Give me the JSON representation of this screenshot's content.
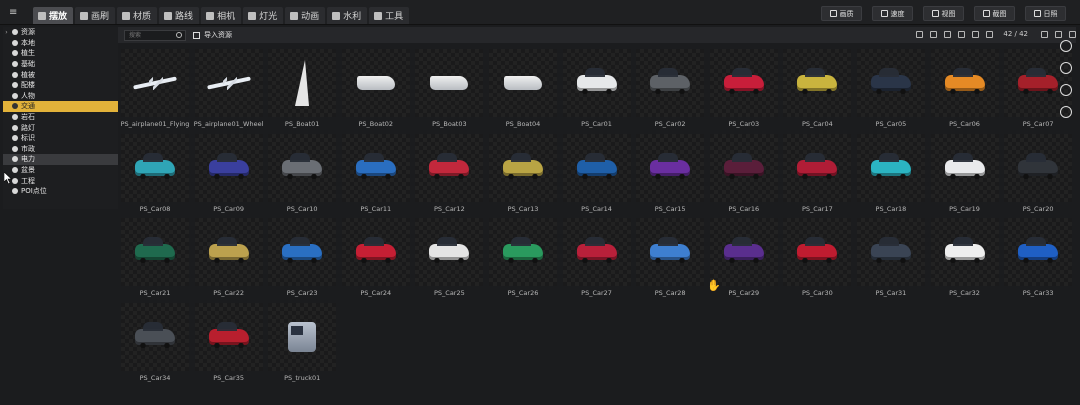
{
  "topbar": {
    "tabs": [
      {
        "label": "摆放",
        "icon": "place-icon",
        "active": true
      },
      {
        "label": "画刷",
        "icon": "brush-icon"
      },
      {
        "label": "材质",
        "icon": "material-icon"
      },
      {
        "label": "路线",
        "icon": "route-icon"
      },
      {
        "label": "相机",
        "icon": "camera-icon"
      },
      {
        "label": "灯光",
        "icon": "light-icon"
      },
      {
        "label": "动画",
        "icon": "animation-icon"
      },
      {
        "label": "水利",
        "icon": "water-icon"
      },
      {
        "label": "工具",
        "icon": "tool-icon"
      }
    ],
    "right_buttons": [
      {
        "label": "画质",
        "icon": "image-quality-icon"
      },
      {
        "label": "速度",
        "icon": "speed-icon"
      },
      {
        "label": "视图",
        "icon": "view-icon"
      },
      {
        "label": "截图",
        "icon": "screenshot-icon"
      },
      {
        "label": "日照",
        "icon": "sun-icon"
      }
    ]
  },
  "sidebar": {
    "items": [
      {
        "label": "资源",
        "arrow": "›"
      },
      {
        "label": "本地",
        "arrow": ""
      },
      {
        "label": "植生",
        "arrow": ""
      },
      {
        "label": "基础",
        "arrow": ""
      },
      {
        "label": "植被",
        "arrow": ""
      },
      {
        "label": "配楼",
        "arrow": ""
      },
      {
        "label": "人物",
        "arrow": ""
      },
      {
        "label": "交通",
        "arrow": "",
        "selected": true
      },
      {
        "label": "岩石",
        "arrow": ""
      },
      {
        "label": "路灯",
        "arrow": ""
      },
      {
        "label": "标识",
        "arrow": ""
      },
      {
        "label": "市政",
        "arrow": ""
      },
      {
        "label": "电力",
        "arrow": "",
        "hover": true
      },
      {
        "label": "盆景",
        "arrow": ""
      },
      {
        "label": "工程",
        "arrow": ""
      },
      {
        "label": "POI点位",
        "arrow": ""
      }
    ]
  },
  "toolbar": {
    "search_placeholder": "搜索",
    "import_label": "导入资源",
    "pager": "42 / 42"
  },
  "assets": [
    {
      "name": "PS_airplane01_Flying",
      "kind": "plane"
    },
    {
      "name": "PS_airplane01_Wheel",
      "kind": "plane"
    },
    {
      "name": "PS_Boat01",
      "kind": "sail"
    },
    {
      "name": "PS_Boat02",
      "kind": "boat"
    },
    {
      "name": "PS_Boat03",
      "kind": "boat"
    },
    {
      "name": "PS_Boat04",
      "kind": "boat"
    },
    {
      "name": "PS_Car01",
      "kind": "car",
      "color": "#e6e8ea"
    },
    {
      "name": "PS_Car02",
      "kind": "car",
      "color": "#5d6166"
    },
    {
      "name": "PS_Car03",
      "kind": "car",
      "color": "#c81e3a"
    },
    {
      "name": "PS_Car04",
      "kind": "car",
      "color": "#c9b43e"
    },
    {
      "name": "PS_Car05",
      "kind": "car",
      "color": "#2a3548"
    },
    {
      "name": "PS_Car06",
      "kind": "car",
      "color": "#e58a25"
    },
    {
      "name": "PS_Car07",
      "kind": "car",
      "color": "#a5202a"
    },
    {
      "name": "PS_Car08",
      "kind": "car",
      "color": "#2fa5b6"
    },
    {
      "name": "PS_Car09",
      "kind": "car",
      "color": "#3a3f9e"
    },
    {
      "name": "PS_Car10",
      "kind": "car",
      "color": "#6a6e74"
    },
    {
      "name": "PS_Car11",
      "kind": "car",
      "color": "#2a6ec0"
    },
    {
      "name": "PS_Car12",
      "kind": "car",
      "color": "#c2283c"
    },
    {
      "name": "PS_Car13",
      "kind": "car",
      "color": "#b9a444"
    },
    {
      "name": "PS_Car14",
      "kind": "car",
      "color": "#1f5fa8"
    },
    {
      "name": "PS_Car15",
      "kind": "car",
      "color": "#6a2ea0"
    },
    {
      "name": "PS_Car16",
      "kind": "car",
      "color": "#5a1e3a"
    },
    {
      "name": "PS_Car17",
      "kind": "car",
      "color": "#b01d36"
    },
    {
      "name": "PS_Car18",
      "kind": "car",
      "color": "#2bb4c2"
    },
    {
      "name": "PS_Car19",
      "kind": "car",
      "color": "#e9eaec"
    },
    {
      "name": "PS_Car20",
      "kind": "car",
      "color": "#30343a"
    },
    {
      "name": "PS_Car21",
      "kind": "car",
      "color": "#1f6a4e"
    },
    {
      "name": "PS_Car22",
      "kind": "car",
      "color": "#bca14e"
    },
    {
      "name": "PS_Car23",
      "kind": "car",
      "color": "#2a6fc2"
    },
    {
      "name": "PS_Car24",
      "kind": "car",
      "color": "#c51f34"
    },
    {
      "name": "PS_Car25",
      "kind": "car",
      "color": "#e4e4e4"
    },
    {
      "name": "PS_Car26",
      "kind": "car",
      "color": "#2a9a5e"
    },
    {
      "name": "PS_Car27",
      "kind": "car",
      "color": "#b8203a"
    },
    {
      "name": "PS_Car28",
      "kind": "car",
      "color": "#3e7fd0"
    },
    {
      "name": "PS_Car29",
      "kind": "car",
      "color": "#5a2e8e"
    },
    {
      "name": "PS_Car30",
      "kind": "car",
      "color": "#c01c30"
    },
    {
      "name": "PS_Car31",
      "kind": "car",
      "color": "#3a4454"
    },
    {
      "name": "PS_Car32",
      "kind": "car",
      "color": "#eeeeee"
    },
    {
      "name": "PS_Car33",
      "kind": "car",
      "color": "#1f5fc4"
    },
    {
      "name": "PS_Car34",
      "kind": "car",
      "color": "#4a4f56"
    },
    {
      "name": "PS_Car35",
      "kind": "car",
      "color": "#b81f2e"
    },
    {
      "name": "PS_truck01",
      "kind": "truck"
    }
  ]
}
